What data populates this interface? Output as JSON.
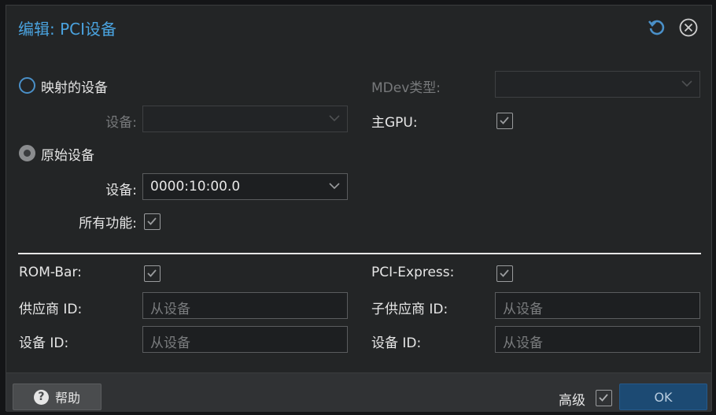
{
  "dialog": {
    "title": "编辑: PCI设备",
    "refresh_icon": "refresh-icon",
    "close_icon": "close-icon"
  },
  "form": {
    "mapped_device_label": "映射的设备",
    "mapped_device_field_label": "设备:",
    "raw_device_label": "原始设备",
    "raw_device_field_label": "设备:",
    "raw_device_value": "0000:10:00.0",
    "all_functions_label": "所有功能:",
    "all_functions_checked": true,
    "mdev_type_label": "MDev类型:",
    "primary_gpu_label": "主GPU:",
    "primary_gpu_checked": true,
    "rom_bar_label": "ROM-Bar:",
    "rom_bar_checked": true,
    "pci_express_label": "PCI-Express:",
    "pci_express_checked": true,
    "vendor_id_label": "供应商 ID:",
    "vendor_id_placeholder": "从设备",
    "device_id_label": "设备 ID:",
    "device_id_placeholder": "从设备",
    "sub_vendor_id_label": "子供应商 ID:",
    "sub_vendor_id_placeholder": "从设备",
    "sub_device_id_label": "设备 ID:",
    "sub_device_id_placeholder": "从设备"
  },
  "footer": {
    "help_label": "帮助",
    "advanced_label": "高级",
    "advanced_checked": true,
    "ok_label": "OK"
  },
  "colors": {
    "accent": "#4aa3df",
    "background": "#232526",
    "ok_button": "#1c4a73"
  }
}
